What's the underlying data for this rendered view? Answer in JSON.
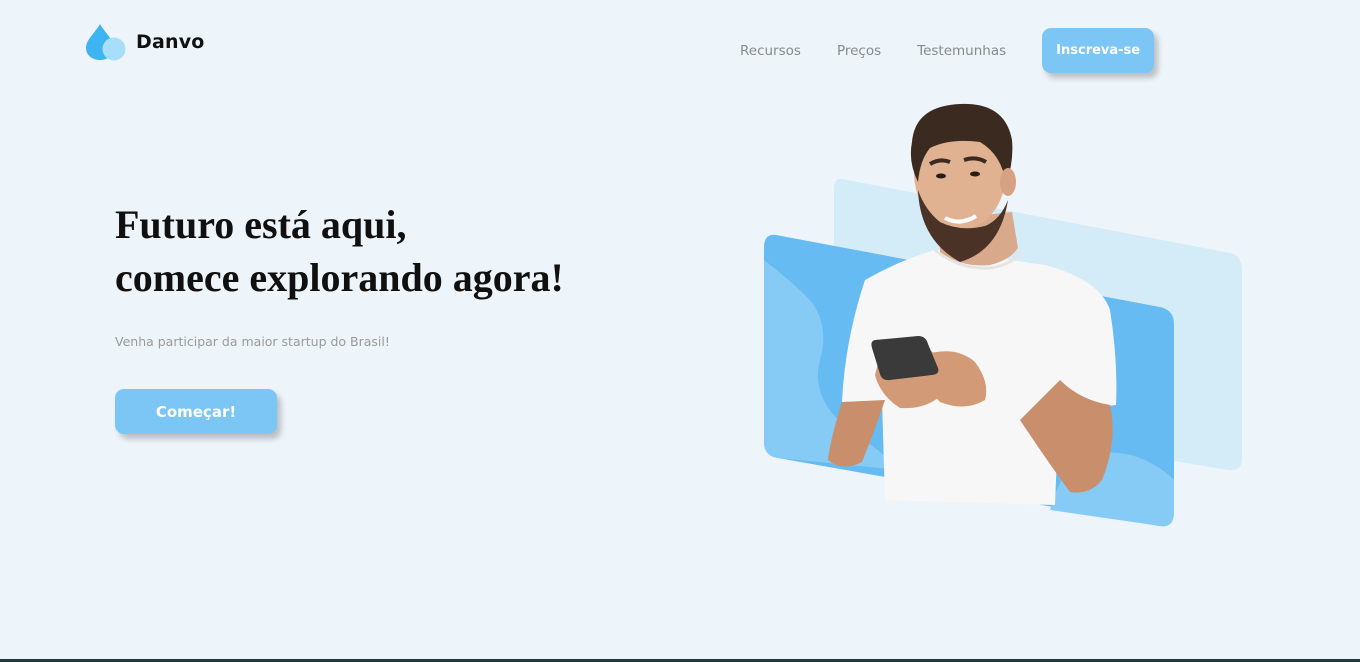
{
  "brand": {
    "name": "Danvo",
    "logo_icon": "water-drop-icon",
    "colors": {
      "drop_dark": "#3fb4f2",
      "drop_light": "#a7dffb"
    }
  },
  "nav": {
    "links": [
      "Recursos",
      "Preços",
      "Testemunhas"
    ],
    "signup_label": "Inscreva-se"
  },
  "hero": {
    "title_line1": "Futuro está aqui,",
    "title_line2": "comece explorando agora!",
    "subtitle": "Venha participar da maior startup do Brasil!",
    "cta_label": "Começar!"
  },
  "colors": {
    "accent": "#7cc6f5",
    "background": "#edf5fa",
    "card_blue": "#66bbf2",
    "card_light": "#d4ebf8"
  },
  "illustration": {
    "subject": "man-with-phone-photo"
  }
}
